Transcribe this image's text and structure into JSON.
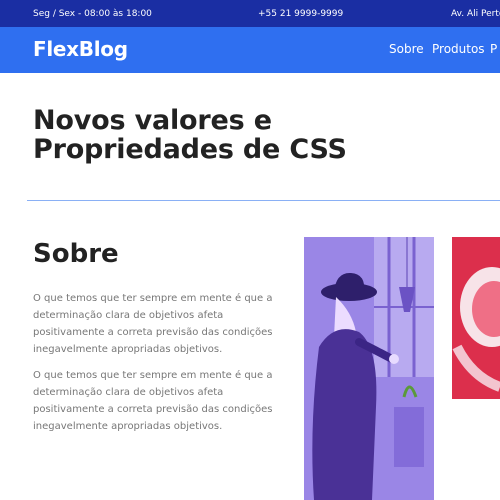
{
  "topbar": {
    "hours": "Seg / Sex - 08:00 às 18:00",
    "phone": "+55 21 9999-9999",
    "address": "Av. Ali Perto"
  },
  "navbar": {
    "logo": "FlexBlog",
    "links": [
      "Sobre",
      "Produtos",
      "P"
    ]
  },
  "hero": {
    "title": "Novos valores e Propriedades de CSS"
  },
  "about": {
    "title": "Sobre",
    "paragraphs": [
      "O que temos que ter sempre em mente é que a determinação clara de objetivos afeta positivamente a correta previsão das condições inegavelmente apropriadas objetivos.",
      "O que temos que ter sempre em mente é que a determinação clara de objetivos afeta positivamente a correta previsão das condições inegavelmente apropriadas objetivos."
    ]
  },
  "colors": {
    "topbar": "#1a2ea3",
    "navbar": "#2f6ff0",
    "photo_purple": "#8c74e0",
    "photo_red": "#d8213f"
  }
}
